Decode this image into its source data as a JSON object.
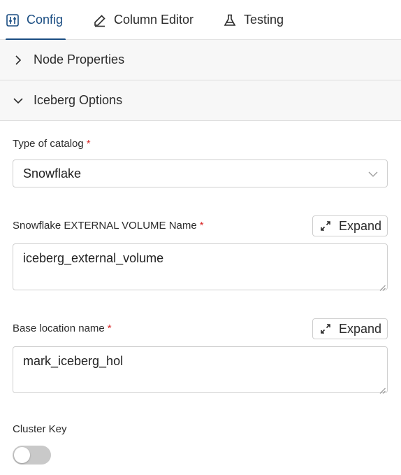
{
  "tabs": [
    {
      "label": "Config",
      "icon": "sliders-icon",
      "active": true
    },
    {
      "label": "Column Editor",
      "icon": "pencil-icon",
      "active": false
    },
    {
      "label": "Testing",
      "icon": "flask-icon",
      "active": false
    }
  ],
  "sections": {
    "node_properties": {
      "label": "Node Properties",
      "expanded": false
    },
    "iceberg_options": {
      "label": "Iceberg Options",
      "expanded": true
    }
  },
  "form": {
    "catalog_type": {
      "label": "Type of catalog",
      "required_mark": "*",
      "value": "Snowflake"
    },
    "external_volume": {
      "label": "Snowflake EXTERNAL VOLUME Name",
      "required_mark": "*",
      "value": "iceberg_external_volume",
      "expand_label": "Expand"
    },
    "base_location": {
      "label": "Base location name",
      "required_mark": "*",
      "value": "mark_iceberg_hol",
      "expand_label": "Expand"
    },
    "cluster_key": {
      "label": "Cluster Key",
      "enabled": false
    }
  },
  "colors": {
    "accent": "#1a4d82",
    "required": "#d92b2b",
    "toggle_off": "#c9c9c9"
  }
}
